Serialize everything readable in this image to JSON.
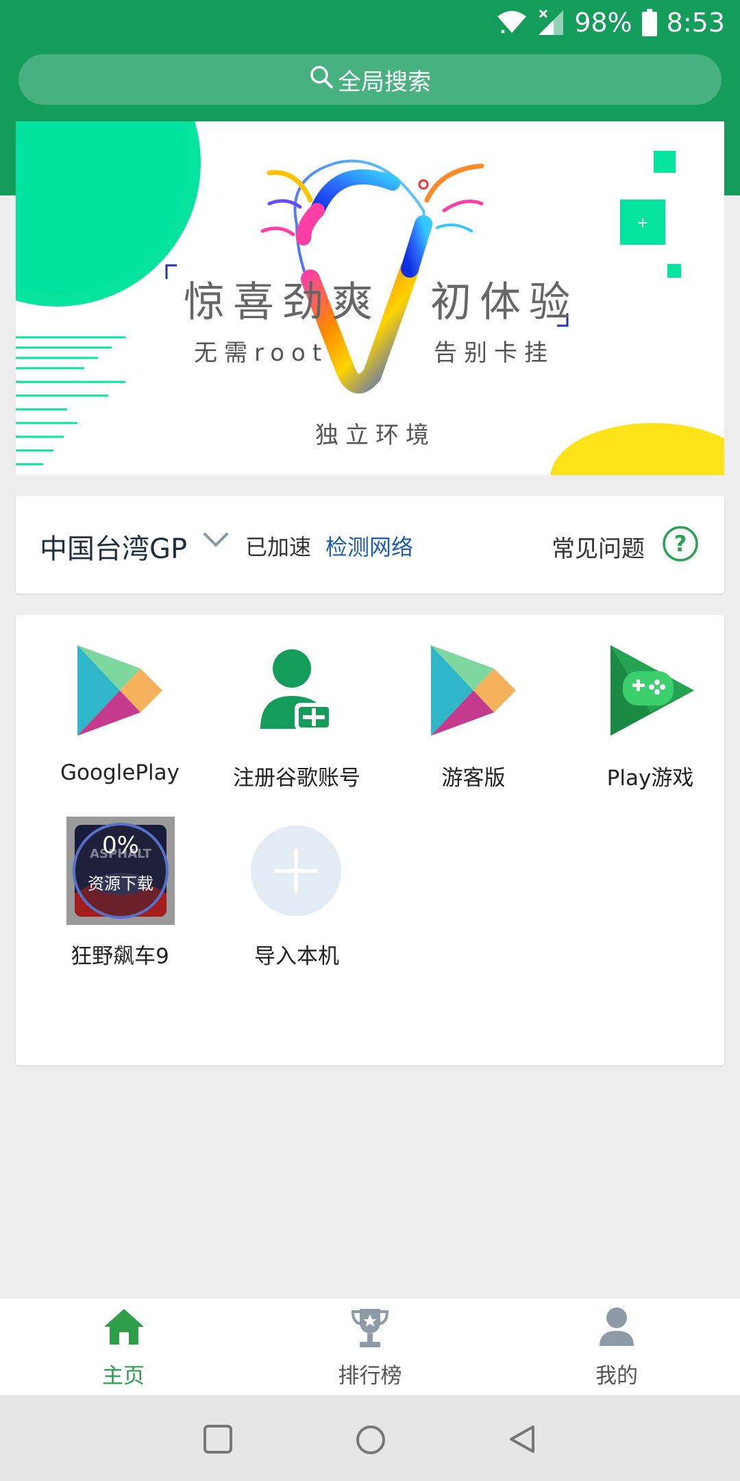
{
  "status_bar": {
    "battery": "98%",
    "time": "8:53"
  },
  "search": {
    "label": "全局搜索"
  },
  "banner": {
    "headline": "惊喜劲爽　初体验",
    "feature_left": "无需root",
    "feature_right": "告别卡挂",
    "feature_bottom": "独立环境"
  },
  "network": {
    "region": "中国台湾GP",
    "status": "已加速",
    "check_link": "检测网络",
    "faq": "常见问题"
  },
  "apps": [
    {
      "label": "GooglePlay",
      "icon": "google-play-icon"
    },
    {
      "label": "注册谷歌账号",
      "icon": "register-google-account-icon"
    },
    {
      "label": "游客版",
      "icon": "google-play-icon"
    },
    {
      "label": "Play游戏",
      "icon": "play-games-icon"
    },
    {
      "label": "狂野飙车9",
      "icon": "asphalt-9-icon",
      "progress": "0%",
      "progress_label": "资源下载"
    },
    {
      "label": "导入本机",
      "icon": "add-icon"
    }
  ],
  "bottom_nav": [
    {
      "label": "主页",
      "icon": "home-icon",
      "active": true
    },
    {
      "label": "排行榜",
      "icon": "trophy-icon",
      "active": false
    },
    {
      "label": "我的",
      "icon": "user-icon",
      "active": false
    }
  ],
  "colors": {
    "brand_green": "#149c5b",
    "active_tab": "#2e9e48",
    "inactive_tab": "#8e9aa8",
    "link_blue": "#1c5bb3"
  }
}
